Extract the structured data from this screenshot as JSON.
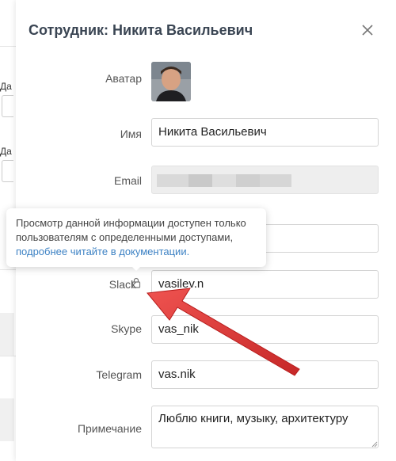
{
  "modal": {
    "title": "Сотрудник: Никита Васильевич",
    "close_icon": "close-icon"
  },
  "fields": {
    "avatar_label": "Аватар",
    "name_label": "Имя",
    "name_value": "Никита Васильевич",
    "email_label": "Email",
    "slack_label": "Slack",
    "slack_value": "vasilev.n",
    "skype_label": "Skype",
    "skype_value": "vas_nik",
    "telegram_label": "Telegram",
    "telegram_value": "vas.nik",
    "note_label": "Примечание",
    "note_value": "Люблю книги, музыку, архитектуру"
  },
  "tooltip": {
    "text": "Просмотр данной информации доступен только пользователям с определенными доступами,",
    "link": "подробнее читайте в документации."
  },
  "background": {
    "label_1": "Да",
    "label_2": "Да"
  },
  "colors": {
    "accent_link": "#3d82c4",
    "arrow": "#e53935"
  },
  "icons": [
    "close-icon",
    "lock-icon"
  ]
}
